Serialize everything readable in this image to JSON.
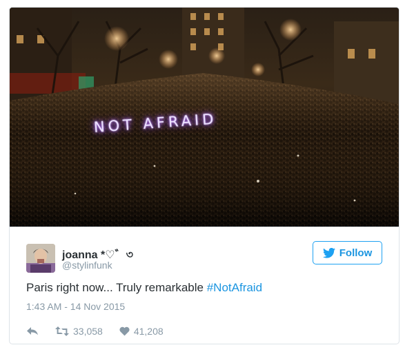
{
  "photo": {
    "sign_text": "NOT AFRAID"
  },
  "user": {
    "display_name": "joanna *♡゛৩",
    "handle": "@stylinfunk"
  },
  "follow": {
    "label": "Follow"
  },
  "tweet": {
    "text": "Paris right now... Truly remarkable ",
    "hashtag": "#NotAfraid",
    "timestamp": "1:43 AM - 14 Nov 2015"
  },
  "actions": {
    "retweets": "33,058",
    "likes": "41,208"
  },
  "colors": {
    "twitter_blue": "#1da1f2",
    "text": "#292f33",
    "muted": "#8899a6"
  }
}
